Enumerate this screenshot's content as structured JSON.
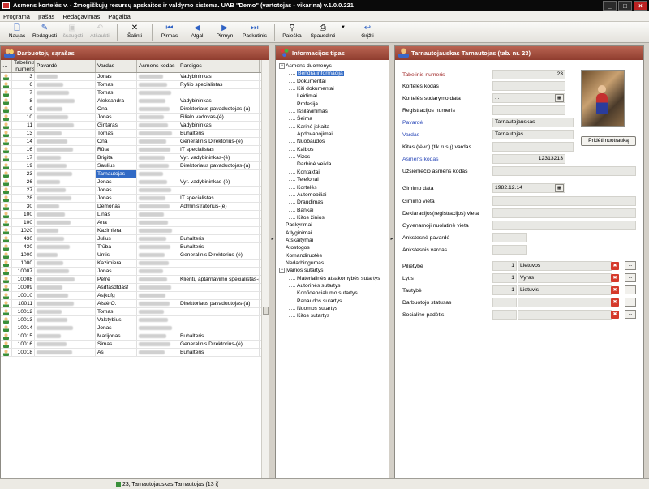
{
  "window": {
    "title": "Asmens kortelės v. - Žmogiškųjų resursų apskaitos ir valdymo sistema. UAB \"Demo\" (vartotojas - vikarina) v.1.0.0.221"
  },
  "menu": [
    "Programa",
    "Įrašas",
    "Redagavimas",
    "Pagalba"
  ],
  "toolbar": {
    "new": "Naujas",
    "edit": "Redaguoti",
    "save": "Išsaugoti",
    "cancel": "Atšaukti",
    "delete": "Šalinti",
    "first": "Pirmas",
    "prev": "Atgal",
    "next": "Pirmyn",
    "last": "Paskutinis",
    "search": "Paieška",
    "print": "Spausdinti",
    "back": "Grįžti"
  },
  "employees": {
    "title": "Darbuotojų sąrašas",
    "columns": [
      "Tabelinis numeris",
      "Pavardė",
      "Vardas",
      "Asmens kodas",
      "Pareigos"
    ],
    "rows": [
      {
        "num": "3",
        "first": "Jonas",
        "role": "Vadybininkas"
      },
      {
        "num": "6",
        "first": "Tomas",
        "role": "Ryšio specialistas"
      },
      {
        "num": "7",
        "first": "Tomas",
        "role": ""
      },
      {
        "num": "8",
        "first": "Aleksandra",
        "role": "Vadybininkas"
      },
      {
        "num": "9",
        "first": "Ona",
        "role": "Direktoriaus pavaduotojas-(a)"
      },
      {
        "num": "10",
        "first": "Jonas",
        "role": "Filialo vadovas-(ė)"
      },
      {
        "num": "11",
        "first": "Gintaras",
        "role": "Vadybininkas"
      },
      {
        "num": "13",
        "first": "Tomas",
        "role": "Buhalteris"
      },
      {
        "num": "14",
        "first": "Ona",
        "role": "Generalinis Direktorius-(ė)"
      },
      {
        "num": "16",
        "first": "Rūta",
        "role": "IT specialistas"
      },
      {
        "num": "17",
        "first": "Brigita",
        "role": "Vyr. vadybininkas-(ė)"
      },
      {
        "num": "19",
        "first": "Saulius",
        "role": "Direktoriaus pavaduotojas-(a)"
      },
      {
        "num": "23",
        "first": "Tarnautojas",
        "role": "",
        "selected": true
      },
      {
        "num": "26",
        "first": "Jonas",
        "role": "Vyr. vadybininkas-(ė)"
      },
      {
        "num": "27",
        "first": "Jonas",
        "role": ""
      },
      {
        "num": "28",
        "first": "Jonas",
        "role": "IT specialistas"
      },
      {
        "num": "30",
        "first": "Demonas",
        "role": "Administratorius-(ė)"
      },
      {
        "num": "100",
        "first": "Linas",
        "role": ""
      },
      {
        "num": "100",
        "first": "Ana",
        "role": ""
      },
      {
        "num": "1020",
        "first": "Kazimiera",
        "role": ""
      },
      {
        "num": "430",
        "first": "Julius",
        "role": "Buhalteris"
      },
      {
        "num": "430",
        "first": "Trūba",
        "role": "Buhalteris"
      },
      {
        "num": "1000",
        "first": "Untis",
        "role": "Generalinis Direktorius-(ė)"
      },
      {
        "num": "1000",
        "first": "Kazimiera",
        "role": ""
      },
      {
        "num": "10007",
        "first": "Jonas",
        "role": ""
      },
      {
        "num": "10008",
        "first": "Petrė",
        "role": "Klientų aptarnavimo specialistas-(ė)"
      },
      {
        "num": "10009",
        "first": "Asdfasdfdasf",
        "role": ""
      },
      {
        "num": "10010",
        "first": "Asjkdfg",
        "role": ""
      },
      {
        "num": "10011",
        "first": "Aistė O.",
        "role": "Direktoriaus pavaduotojas-(a)"
      },
      {
        "num": "10012",
        "first": "Tomas",
        "role": ""
      },
      {
        "num": "10013",
        "first": "Valstybius",
        "role": ""
      },
      {
        "num": "10014",
        "first": "Jonas",
        "role": ""
      },
      {
        "num": "10015",
        "first": "Marijonas",
        "role": "Buhalteris"
      },
      {
        "num": "10016",
        "first": "Simas",
        "role": "Generalinis Direktorius-(ė)"
      },
      {
        "num": "10018",
        "first": "As",
        "role": "Buhalteris"
      }
    ]
  },
  "info": {
    "title": "Informacijos tipas",
    "tree": [
      {
        "label": "Asmens duomenys",
        "level": 0,
        "expanded": true
      },
      {
        "label": "Bendra informacija",
        "level": 1,
        "selected": true
      },
      {
        "label": "Dokumentai",
        "level": 1
      },
      {
        "label": "Kiti dokumentai",
        "level": 1
      },
      {
        "label": "Leidimai",
        "level": 1
      },
      {
        "label": "Profesija",
        "level": 1
      },
      {
        "label": "Išsilavinimas",
        "level": 1
      },
      {
        "label": "Šeima",
        "level": 1
      },
      {
        "label": "Karinė įskaita",
        "level": 1
      },
      {
        "label": "Apdovanojimai",
        "level": 1
      },
      {
        "label": "Nuobaudos",
        "level": 1
      },
      {
        "label": "Kalbos",
        "level": 1
      },
      {
        "label": "Vizos",
        "level": 1
      },
      {
        "label": "Darbinė veikla",
        "level": 1
      },
      {
        "label": "Kontaktai",
        "level": 1
      },
      {
        "label": "Telefonai",
        "level": 1
      },
      {
        "label": "Kortelės",
        "level": 1
      },
      {
        "label": "Automobiliai",
        "level": 1
      },
      {
        "label": "Draudimas",
        "level": 1
      },
      {
        "label": "Bankai",
        "level": 1
      },
      {
        "label": "Kitos žinios",
        "level": 1
      },
      {
        "label": "Paskyrimai",
        "level": 0
      },
      {
        "label": "Atlyginimai",
        "level": 0
      },
      {
        "label": "Atskaitymai",
        "level": 0
      },
      {
        "label": "Atostogos",
        "level": 0
      },
      {
        "label": "Komandiruotės",
        "level": 0
      },
      {
        "label": "Nedarbingumas",
        "level": 0
      },
      {
        "label": "Įvairios sutartys",
        "level": 0,
        "expanded": true
      },
      {
        "label": "Materialinės atsakomybės sutartys",
        "level": 1
      },
      {
        "label": "Autorinės sutartys",
        "level": 1
      },
      {
        "label": "Konfidencialumo sutartys",
        "level": 1
      },
      {
        "label": "Panaudos sutartys",
        "level": 1
      },
      {
        "label": "Nuomos sutartys",
        "level": 1
      },
      {
        "label": "Kitos sutartys",
        "level": 1
      }
    ]
  },
  "detail": {
    "title": "Tarnautojauskas Tarnautojas (tab. nr. 23)",
    "add_photo": "Pridėti nuotrauką",
    "labels": {
      "tab": "Tabelinis numeris",
      "card_code": "Kortelės kodas",
      "card_date": "Kortelės sudarymo data",
      "reg": "Registracijos numeris",
      "surname": "Pavardė",
      "name": "Vardas",
      "fathername": "Kitas (tėvo) (tik rusų) vardas",
      "code": "Asmens kodas",
      "foreign": "Užsieniečio asmens kodas",
      "birthdate": "Gimimo data",
      "birthplace": "Gimimo vieta",
      "declared": "Deklaracijos(registracijos) vieta",
      "residence": "Gyvenamoji nuolatinė vieta",
      "prevsurname": "Ankstesnė pavardė",
      "prevname": "Ankstesnis vardas",
      "citizenship": "Pilietybė",
      "gender": "Lytis",
      "nationality": "Tautybė",
      "workstatus": "Darbuotojo statusas",
      "social": "Socialinė padėtis"
    },
    "values": {
      "tab": "23",
      "card_date": ". .",
      "surname": "Tarnautojauskas",
      "name": "Tarnautojas",
      "code": "12313213",
      "birthdate": "1982.12.14",
      "citizenship_num": "1",
      "citizenship": "Lietuvos",
      "gender_num": "1",
      "gender": "Vyras",
      "nationality_num": "1",
      "nationality": "Lietuvis"
    }
  },
  "status": {
    "text": "23, Tarnautojauskas Tarnautojas (13 i("
  }
}
